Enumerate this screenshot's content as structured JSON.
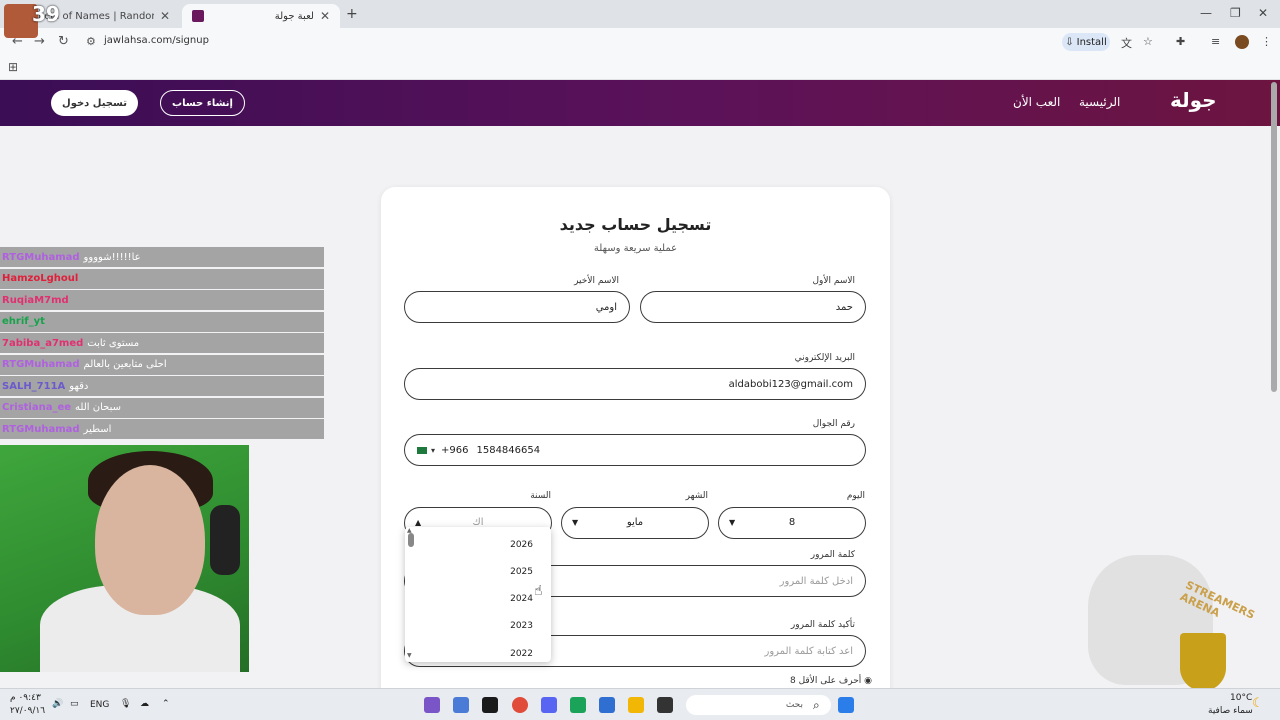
{
  "browser": {
    "tabs": [
      {
        "label": "Wheel of Names | Random nam",
        "active": false
      },
      {
        "label": "لعبة جولة",
        "active": true
      }
    ],
    "url": "jawlahsa.com/signup",
    "install_label": "Install"
  },
  "site": {
    "logo": "جولة",
    "nav": [
      "الرئيسية",
      "العب الأن"
    ],
    "signup_button": "إنشاء حساب",
    "login_button": "تسجيل دخول"
  },
  "form": {
    "title": "تسجيل حساب جديد",
    "subtitle": "عملية سريعة وسهلة",
    "first_name_label": "الاسم الأول",
    "first_name_value": "حمد",
    "last_name_label": "الاسم الأخير",
    "last_name_value": "اومي",
    "email_label": "البريد الإلكتروني",
    "email_value": "aldabobi123@gmail.com",
    "phone_label": "رقم الجوال",
    "phone_code": "+966",
    "phone_value": "1584846654",
    "day_label": "اليوم",
    "day_value": "8",
    "month_label": "الشهر",
    "month_value": "مايو",
    "year_label": "السنة",
    "year_placeholder": "اك",
    "year_options": [
      "2026",
      "2025",
      "2024",
      "2023",
      "2022"
    ],
    "password_label": "كلمة المرور",
    "password_placeholder": "ادخل كلمة المرور",
    "confirm_label": "تأكيد كلمة المرور",
    "confirm_placeholder": "اعد كتابة كلمة المرور",
    "rule_hint": "8 أحرف على الأقل"
  },
  "stream": {
    "counter": "39",
    "chat": [
      {
        "user": "RTGMuhamad",
        "msg": "عا!!!!!شوووو",
        "color": "#b060e0"
      },
      {
        "user": "HamzoLghoul",
        "msg": "",
        "color": "#e0203a"
      },
      {
        "user": "RuqiaM7md",
        "msg": "",
        "color": "#e03070"
      },
      {
        "user": "ehrif_yt",
        "msg": "",
        "color": "#16a34a"
      },
      {
        "user": "7abiba_a7med",
        "msg": "مستوى ثابت",
        "color": "#e03070"
      },
      {
        "user": "RTGMuhamad",
        "msg": "احلى متابعين بالعالم",
        "color": "#b060e0"
      },
      {
        "user": "SALH_711A",
        "msg": "دقهو",
        "color": "#6a5acd"
      },
      {
        "user": "Cristiana_ee",
        "msg": "سبحان الله",
        "color": "#b060e0"
      },
      {
        "user": "RTGMuhamad",
        "msg": "اسطير",
        "color": "#b060e0"
      }
    ],
    "watermark": "STREAMERS ARENA"
  },
  "taskbar": {
    "lang": "ENG",
    "time": "٠٩:٤٣ م",
    "date": "٢٧/٠٩/١٦",
    "search": "بحث",
    "temp": "10°C",
    "weather": "سماء صافية"
  }
}
